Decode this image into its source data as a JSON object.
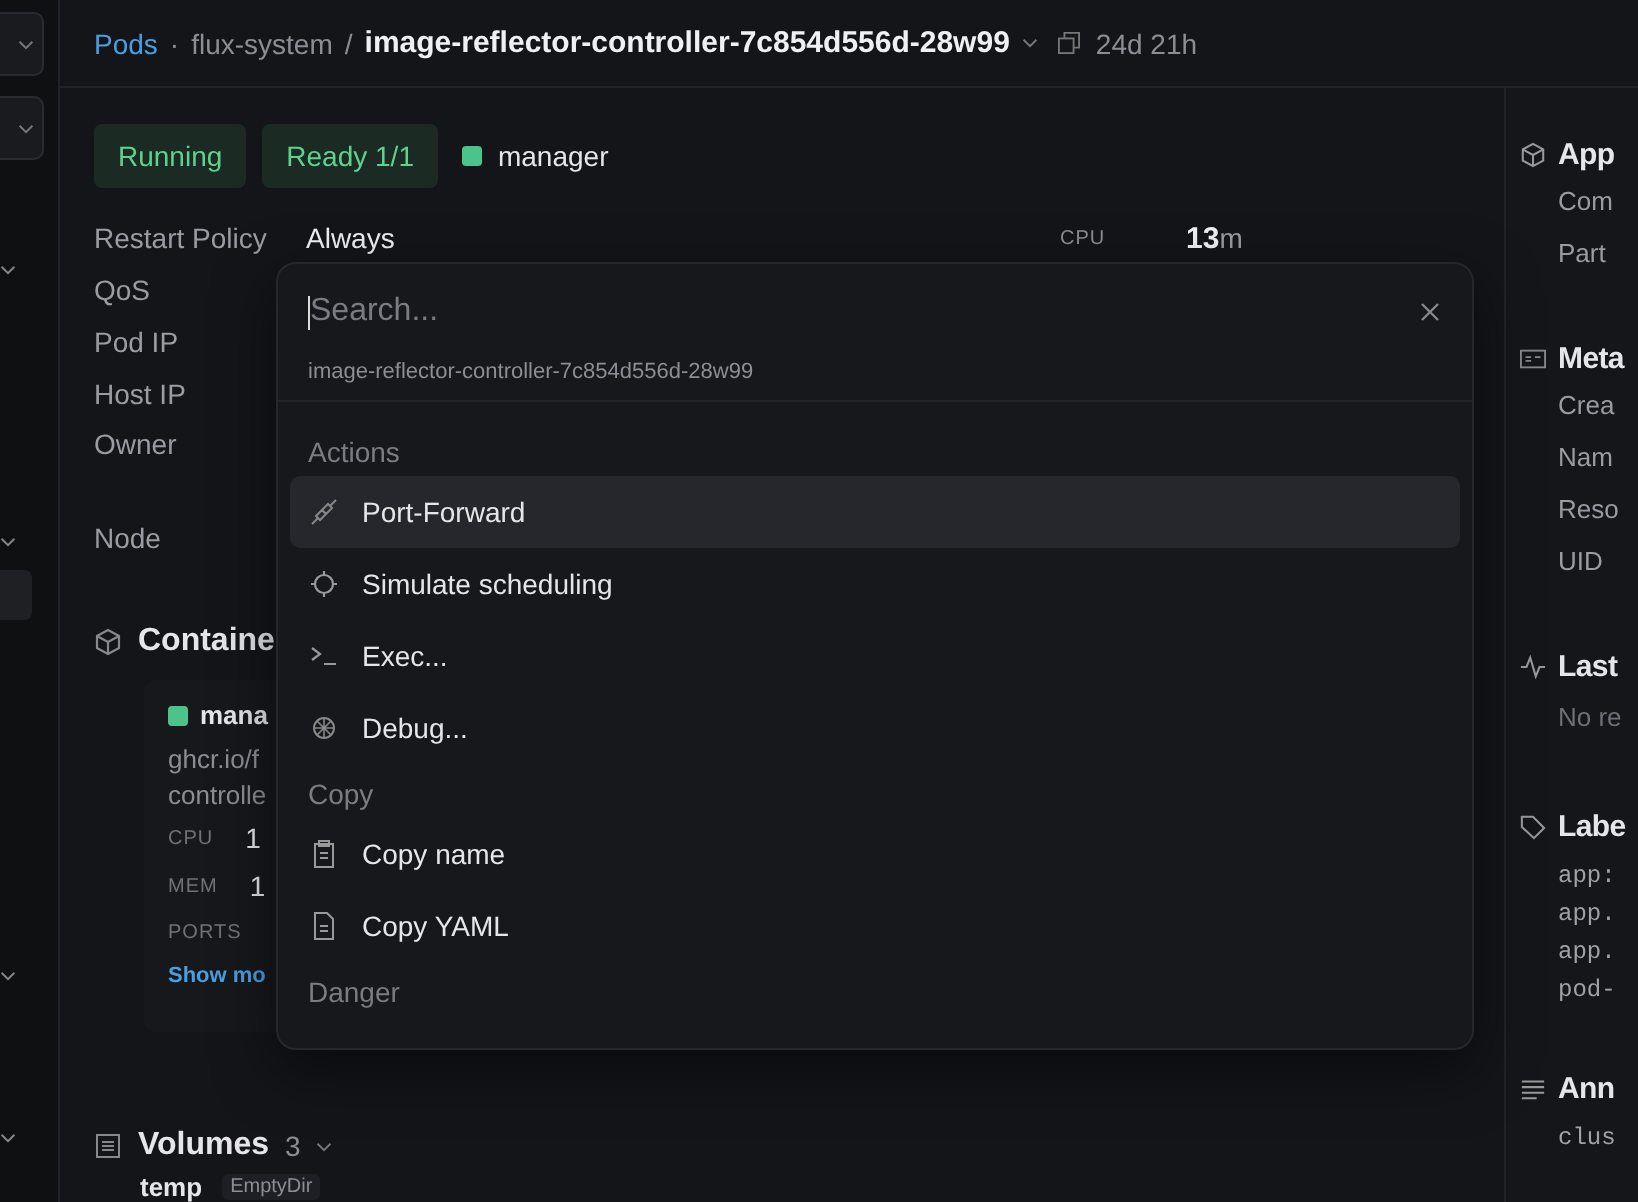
{
  "header": {
    "crumb_link": "Pods",
    "parent_separator": "·",
    "namespace": "flux-system",
    "title_separator": "/",
    "title": "image-reflector-controller-7c854d556d-28w99",
    "age": "24d 21h"
  },
  "badges": [
    {
      "label": "Running"
    },
    {
      "label": "Ready 1/1"
    }
  ],
  "container_status": {
    "label": "manager"
  },
  "details": [
    {
      "label": "Restart Policy",
      "value": "Always"
    },
    {
      "label": "QoS"
    },
    {
      "label": "Pod IP"
    },
    {
      "label": "Host IP"
    },
    {
      "label": "Owner"
    },
    {
      "label": "Node"
    }
  ],
  "usage": {
    "label": "CPU",
    "value": "13",
    "unit": "m"
  },
  "containers": {
    "title": "Containe",
    "card": {
      "name": "mana",
      "image_lines": [
        "ghcr.io/f",
        "controlle"
      ],
      "metrics": [
        {
          "label": "CPU",
          "value": "1"
        },
        {
          "label": "MEM",
          "value": "1"
        }
      ],
      "ports_label": "PORTS",
      "show_more": "Show mo"
    }
  },
  "volumes": {
    "title": "Volumes",
    "count": "3",
    "items": [
      {
        "name": "temp",
        "type": "EmptyDir"
      }
    ]
  },
  "right_panel": [
    {
      "title": "App",
      "kind": "plain",
      "rows": [
        "Com",
        "Part"
      ]
    },
    {
      "title": "Meta",
      "kind": "plain",
      "rows": [
        "Crea",
        "Nam",
        "Reso",
        "UID"
      ]
    },
    {
      "title": "Last",
      "kind": "muted",
      "rows": [
        "No re"
      ]
    },
    {
      "title": "Labe",
      "kind": "mono",
      "rows": [
        "app:",
        "app.",
        "app.",
        "pod-"
      ]
    },
    {
      "title": "Ann",
      "kind": "mono",
      "rows": [
        "clus"
      ]
    }
  ],
  "palette": {
    "placeholder": "Search...",
    "subject": "image-reflector-controller-7c854d556d-28w99",
    "groups": [
      {
        "title": "Actions",
        "items": [
          {
            "label": "Port-Forward",
            "selected": true
          },
          {
            "label": "Simulate scheduling",
            "selected": false
          },
          {
            "label": "Exec...",
            "selected": false
          },
          {
            "label": "Debug...",
            "selected": false
          }
        ]
      },
      {
        "title": "Copy",
        "items": [
          {
            "label": "Copy name",
            "selected": false
          },
          {
            "label": "Copy YAML",
            "selected": false
          }
        ]
      },
      {
        "title": "Danger"
      }
    ]
  }
}
